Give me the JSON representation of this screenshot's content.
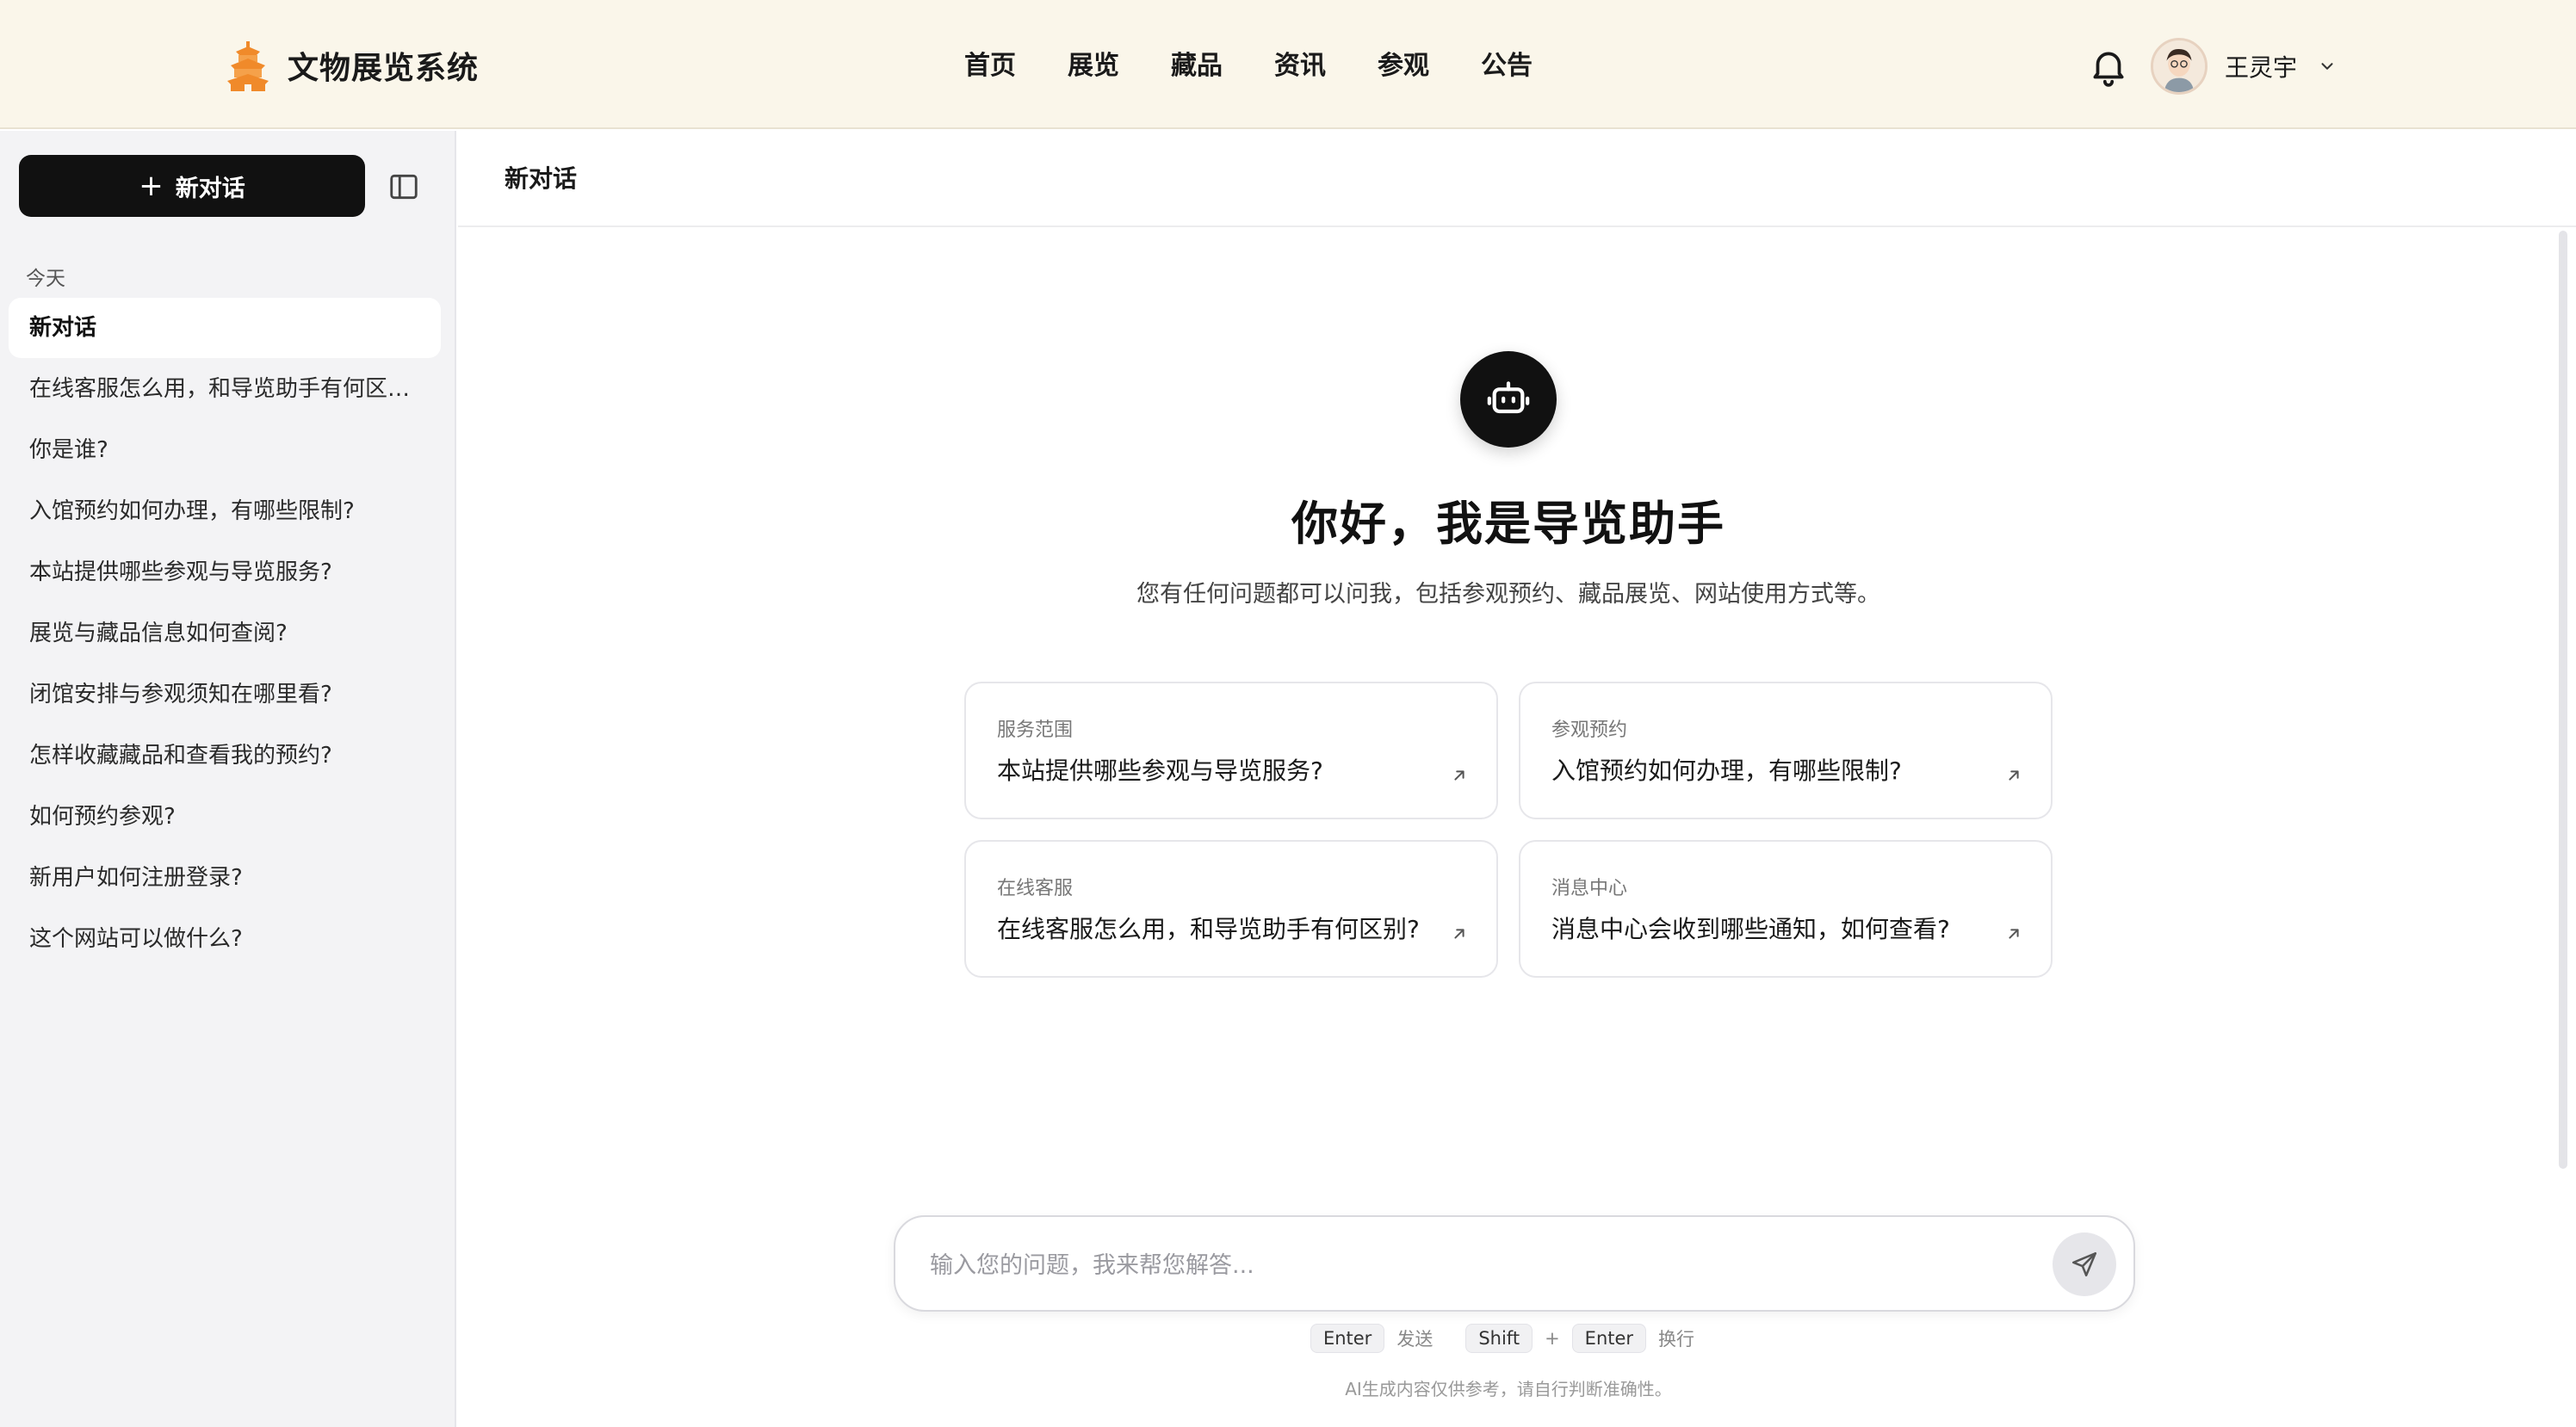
{
  "header": {
    "brand": "文物展览系统",
    "nav": [
      "首页",
      "展览",
      "藏品",
      "资讯",
      "参观",
      "公告"
    ],
    "user_name": "王灵宇"
  },
  "sidebar": {
    "new_chat_label": "新对话",
    "group_today": "今天",
    "history": [
      "新对话",
      "在线客服怎么用，和导览助手有何区别？",
      "你是谁?",
      "入馆预约如何办理，有哪些限制?",
      "本站提供哪些参观与导览服务?",
      "展览与藏品信息如何查阅?",
      "闭馆安排与参观须知在哪里看?",
      "怎样收藏藏品和查看我的预约?",
      "如何预约参观?",
      "新用户如何注册登录?",
      "这个网站可以做什么?"
    ],
    "active_index": 0
  },
  "main": {
    "title": "新对话",
    "greeting": "你好，我是导览助手",
    "intro": "您有任何问题都可以问我，包括参观预约、藏品展览、网站使用方式等。",
    "cards": [
      {
        "category": "服务范围",
        "question": "本站提供哪些参观与导览服务?"
      },
      {
        "category": "参观预约",
        "question": "入馆预约如何办理，有哪些限制?"
      },
      {
        "category": "在线客服",
        "question": "在线客服怎么用，和导览助手有何区别?"
      },
      {
        "category": "消息中心",
        "question": "消息中心会收到哪些通知，如何查看?"
      }
    ],
    "input_placeholder": "输入您的问题，我来帮您解答...",
    "hint": {
      "send_key": "Enter",
      "send_label": "发送",
      "mod_key": "Shift",
      "plus": "+",
      "newline_key": "Enter",
      "newline_label": "换行"
    },
    "disclaimer": "AI生成内容仅供参考，请自行判断准确性。"
  },
  "icons": {
    "brand": "pagoda-icon",
    "bell": "bell-icon",
    "caret": "chevron-down-icon",
    "panel": "sidebar-toggle-icon",
    "bot": "robot-icon",
    "arrow": "arrow-up-right-icon",
    "send": "send-icon"
  },
  "colors": {
    "header_bg": "#faf6ea",
    "brand_orange": "#f08a2a",
    "primary_dark": "#111111",
    "sidebar_bg": "#f3f3f5"
  }
}
